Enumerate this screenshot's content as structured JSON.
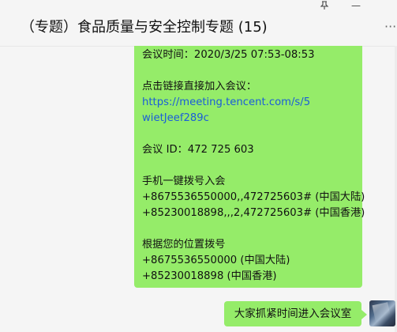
{
  "header": {
    "title": "（专题）食品质量与安全控制专题 (15)",
    "pin_icon": "pin-icon",
    "minimize_glyph": "—",
    "more_glyph": "···"
  },
  "messages": {
    "meeting_info": {
      "time_line": "会议时间：2020/3/25 07:53-08:53",
      "join_prompt": "点击链接直接加入会议：",
      "link_part1": "https://meeting.tencent.com/s/5",
      "link_part2": "wietJeef289c",
      "meeting_id": "会议 ID：472 725 603",
      "one_tap_heading": "手机一键拨号入会",
      "one_tap_mainland": "+8675536550000,,472725603# (中国大陆)",
      "one_tap_hk": "+85230018898,,,2,472725603# (中国香港)",
      "dial_heading": "根据您的位置拨号",
      "dial_mainland": "+8675536550000 (中国大陆)",
      "dial_hk": "+85230018898 (中国香港)"
    },
    "short_message": "大家抓紧时间进入会议室"
  },
  "colors": {
    "bubble": "#95ec69",
    "link": "#1a5dd9",
    "background": "#f5f5f5"
  }
}
